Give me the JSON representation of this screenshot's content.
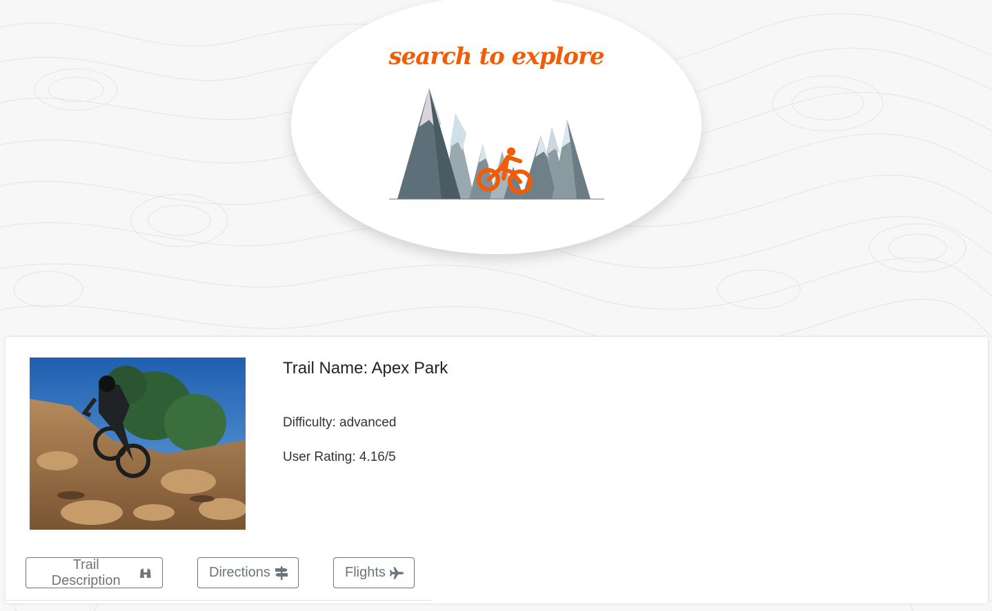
{
  "hero": {
    "title": "search to explore",
    "logo_icon": "mountain-bike-logo",
    "accent_color": "#f25c05"
  },
  "trail": {
    "name_label": "Trail Name: Apex Park",
    "difficulty_label": "Difficulty: advanced",
    "rating_label": "User Rating: 4.16/5",
    "photo": "mountain-biker-on-rocky-trail"
  },
  "actions": {
    "description_label": "Trail Description",
    "description_icon": "binoculars-icon",
    "directions_label": "Directions",
    "directions_icon": "signpost-icon",
    "flights_label": "Flights",
    "flights_icon": "plane-icon"
  }
}
